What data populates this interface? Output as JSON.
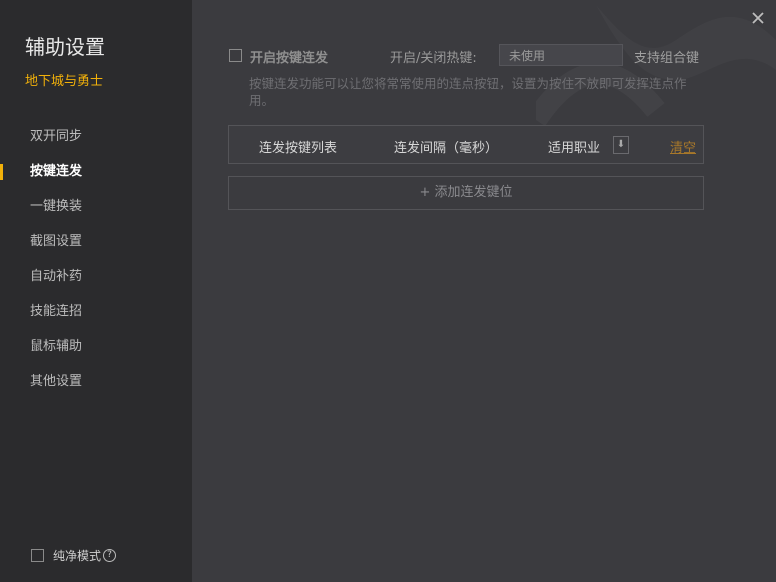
{
  "sidebar": {
    "title": "辅助设置",
    "game": "地下城与勇士",
    "items": [
      {
        "label": "双开同步"
      },
      {
        "label": "按键连发"
      },
      {
        "label": "一键换装"
      },
      {
        "label": "截图设置"
      },
      {
        "label": "自动补药"
      },
      {
        "label": "技能连招"
      },
      {
        "label": "鼠标辅助"
      },
      {
        "label": "其他设置"
      }
    ],
    "active_item": "按键连发",
    "pure_mode_label": "纯净模式",
    "help_glyph": "?"
  },
  "main": {
    "enable_label": "开启按键连发",
    "enabled": false,
    "hotkey_label": "开启/关闭热键:",
    "hotkey_value": "未使用",
    "combo_label": "支持组合键",
    "description": "按键连发功能可以让您将常常使用的连点按钮，设置为按住不放即可发挥连点作用。",
    "table": {
      "columns": [
        "连发按键列表",
        "连发间隔（毫秒）",
        "适用职业"
      ],
      "clear_label": "清空"
    },
    "add_button_label": "+ 添加连发键位"
  },
  "window": {
    "close_icon": "close-icon"
  },
  "colors": {
    "accent": "#f2b10a",
    "sidebar_bg": "#2b2b2d",
    "main_bg": "#3b3b3f",
    "link": "#a8782a"
  }
}
